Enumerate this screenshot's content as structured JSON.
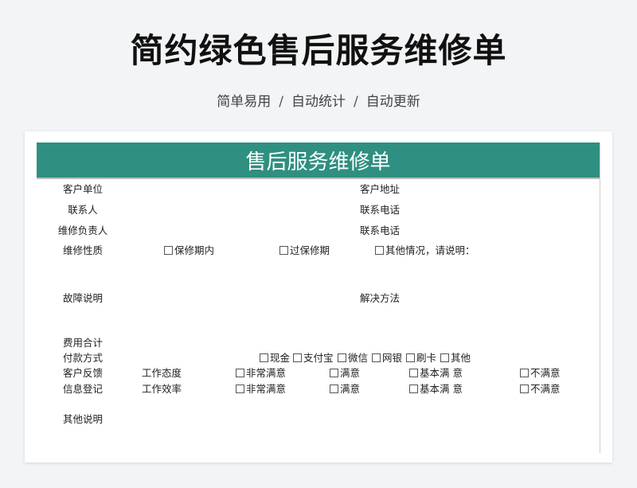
{
  "page": {
    "title": "简约绿色售后服务维修单",
    "subtitle_parts": [
      "简单易用",
      "自动统计",
      "自动更新"
    ],
    "subtitle_sep": "/"
  },
  "form": {
    "header": "售后服务维修单",
    "labels": {
      "customer_unit": "客户单位",
      "customer_address": "客户地址",
      "contact": "联系人",
      "contact_phone": "联系电话",
      "repair_manager": "维修负责人",
      "contact_phone_2": "联系电话",
      "repair_nature": "维修性质",
      "fault_desc": "故障说明",
      "solution": "解决方法",
      "cost_total": "费用合计",
      "payment": "付款方式",
      "feedback": "客户反馈",
      "info_register": "信息登记",
      "other_desc": "其他说明",
      "work_attitude": "工作态度",
      "work_efficiency": "工作效率"
    },
    "repair_options": [
      "保修期内",
      "过保修期",
      "其他情况，请说明："
    ],
    "payment_options": [
      "现金",
      "支付宝",
      "微信",
      "网银",
      "刷卡",
      "其他"
    ],
    "rating_options": [
      "非常满意",
      "满意",
      "基本满 意",
      "不满意"
    ],
    "accent_color": "#2f8f80"
  }
}
